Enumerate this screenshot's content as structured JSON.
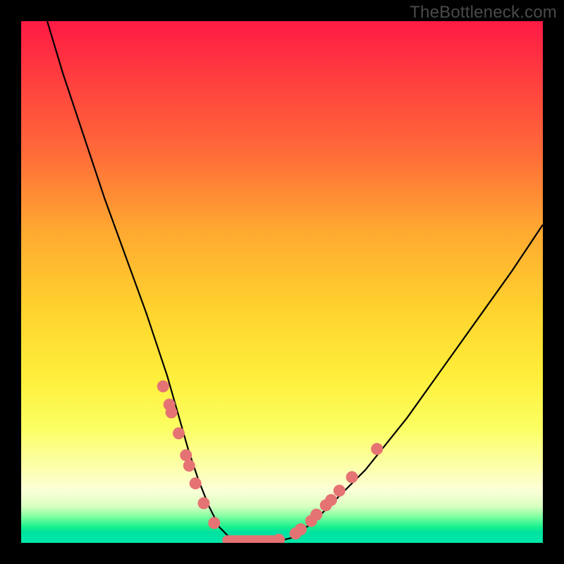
{
  "watermark": "TheBottleneck.com",
  "colors": {
    "frame": "#000000",
    "gradient_top": "#ff1a45",
    "gradient_mid": "#ffd22e",
    "gradient_bottom": "#00e1a0",
    "curve": "#000000",
    "dots": "#e67373"
  },
  "chart_data": {
    "type": "line",
    "title": "",
    "xlabel": "",
    "ylabel": "",
    "xlim": [
      0,
      100
    ],
    "ylim": [
      0,
      100
    ],
    "grid": false,
    "legend": false,
    "series": [
      {
        "name": "bottleneck-curve",
        "x": [
          5,
          8,
          12,
          16,
          20,
          24,
          26,
          28,
          30,
          32,
          34,
          36,
          38,
          40,
          44,
          48,
          52,
          56,
          60,
          66,
          74,
          84,
          94,
          100
        ],
        "y": [
          100,
          90,
          78,
          66,
          55,
          44,
          38,
          32,
          25,
          18,
          12,
          7,
          3,
          1,
          0,
          0,
          1,
          4,
          8,
          14,
          24,
          38,
          52,
          61
        ]
      }
    ],
    "markers": {
      "name": "data-dots",
      "points": [
        {
          "x": 27.2,
          "y": 30.0
        },
        {
          "x": 28.4,
          "y": 26.5
        },
        {
          "x": 28.8,
          "y": 25.0
        },
        {
          "x": 30.2,
          "y": 21.0
        },
        {
          "x": 31.6,
          "y": 16.8
        },
        {
          "x": 32.2,
          "y": 14.8
        },
        {
          "x": 33.4,
          "y": 11.4
        },
        {
          "x": 35.0,
          "y": 7.6
        },
        {
          "x": 37.0,
          "y": 3.8
        },
        {
          "x": 49.4,
          "y": 0.6
        },
        {
          "x": 52.6,
          "y": 1.8
        },
        {
          "x": 53.6,
          "y": 2.6
        },
        {
          "x": 55.6,
          "y": 4.2
        },
        {
          "x": 56.6,
          "y": 5.4
        },
        {
          "x": 58.4,
          "y": 7.2
        },
        {
          "x": 59.4,
          "y": 8.2
        },
        {
          "x": 61.0,
          "y": 10.0
        },
        {
          "x": 63.4,
          "y": 12.6
        },
        {
          "x": 68.2,
          "y": 18.0
        }
      ]
    },
    "flat_segment": {
      "x_start": 39.5,
      "x_end": 49.5,
      "y": 0.5
    }
  }
}
